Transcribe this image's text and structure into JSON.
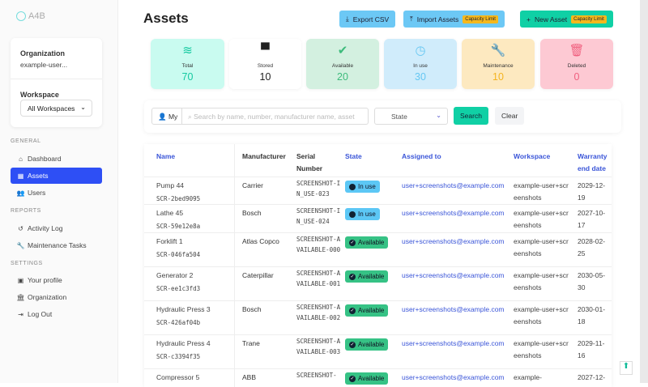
{
  "sidebar": {
    "logo": "A4B",
    "org_label": "Organization",
    "org_value": "example-user...",
    "workspace_label": "Workspace",
    "workspace_value": "All Workspaces",
    "sections": {
      "general": "GENERAL",
      "reports": "REPORTS",
      "settings": "SETTINGS"
    },
    "items": [
      {
        "label": "Dashboard",
        "icon": "home-icon"
      },
      {
        "label": "Assets",
        "icon": "boxes-icon"
      },
      {
        "label": "Users",
        "icon": "users-icon"
      },
      {
        "label": "Activity Log",
        "icon": "history-icon"
      },
      {
        "label": "Maintenance Tasks",
        "icon": "wrench-icon"
      },
      {
        "label": "Your profile",
        "icon": "id-card-icon"
      },
      {
        "label": "Organization",
        "icon": "bank-icon"
      },
      {
        "label": "Log Out",
        "icon": "logout-icon"
      }
    ]
  },
  "header": {
    "title": "Assets",
    "export": "Export CSV",
    "import": "Import Assets",
    "new": "New Asset",
    "capacity": "Capacity Limit"
  },
  "stats": [
    {
      "label": "Total",
      "value": "70",
      "color": "#15c9a0",
      "bg": "#c9fbf0"
    },
    {
      "label": "Stored",
      "value": "10",
      "color": "#222",
      "bg": "#ffffff"
    },
    {
      "label": "Available",
      "value": "20",
      "color": "#3dbb7c",
      "bg": "#d3f0e0"
    },
    {
      "label": "In use",
      "value": "30",
      "color": "#66c7f2",
      "bg": "#d0ecfb"
    },
    {
      "label": "Maintenance",
      "value": "10",
      "color": "#f4b420",
      "bg": "#fde9c0"
    },
    {
      "label": "Deleted",
      "value": "0",
      "color": "#f0607f",
      "bg": "#fdc9d3"
    }
  ],
  "filter": {
    "my": "My",
    "search_placeholder": "Search by name, number, manufacturer name, asset",
    "state": "State",
    "search": "Search",
    "clear": "Clear"
  },
  "table": {
    "headers": [
      "Name",
      "Manufacturer",
      "Serial Number",
      "State",
      "Assigned to",
      "Workspace",
      "Warranty end date"
    ],
    "rows": [
      {
        "name": "Pump 44",
        "code": "SCR-2bed9095",
        "mfr": "Carrier",
        "serial": "SCREENSHOT-IN_USE-023",
        "state": "In use",
        "assigned": "user+screenshots@example.com",
        "ws": "example-user+screenshots",
        "warranty": "2029-12-19"
      },
      {
        "name": "Lathe 45",
        "code": "SCR-59e12e8a",
        "mfr": "Bosch",
        "serial": "SCREENSHOT-IN_USE-024",
        "state": "In use",
        "assigned": "user+screenshots@example.com",
        "ws": "example-user+screenshots",
        "warranty": "2027-10-17"
      },
      {
        "name": "Forklift 1",
        "code": "SCR-046fa504",
        "mfr": "Atlas Copco",
        "serial": "SCREENSHOT-AVAILABLE-000",
        "state": "Available",
        "assigned": "user+screenshots@example.com",
        "ws": "example-user+screenshots",
        "warranty": "2028-02-25"
      },
      {
        "name": "Generator 2",
        "code": "SCR-ee1c3fd3",
        "mfr": "Caterpillar",
        "serial": "SCREENSHOT-AVAILABLE-001",
        "state": "Available",
        "assigned": "user+screenshots@example.com",
        "ws": "example-user+screenshots",
        "warranty": "2030-05-30"
      },
      {
        "name": "Hydraulic Press 3",
        "code": "SCR-426af04b",
        "mfr": "Bosch",
        "serial": "SCREENSHOT-AVAILABLE-002",
        "state": "Available",
        "assigned": "user+screenshots@example.com",
        "ws": "example-user+screenshots",
        "warranty": "2030-01-18"
      },
      {
        "name": "Hydraulic Press 4",
        "code": "SCR-c3394f35",
        "mfr": "Trane",
        "serial": "SCREENSHOT-AVAILABLE-003",
        "state": "Available",
        "assigned": "user+screenshots@example.com",
        "ws": "example-user+screenshots",
        "warranty": "2029-11-16"
      },
      {
        "name": "Compressor 5",
        "code": "",
        "mfr": "ABB",
        "serial": "SCREENSHOT-",
        "state": "Available",
        "assigned": "user+screenshots@example.com",
        "ws": "example-",
        "warranty": "2027-12-"
      }
    ]
  }
}
